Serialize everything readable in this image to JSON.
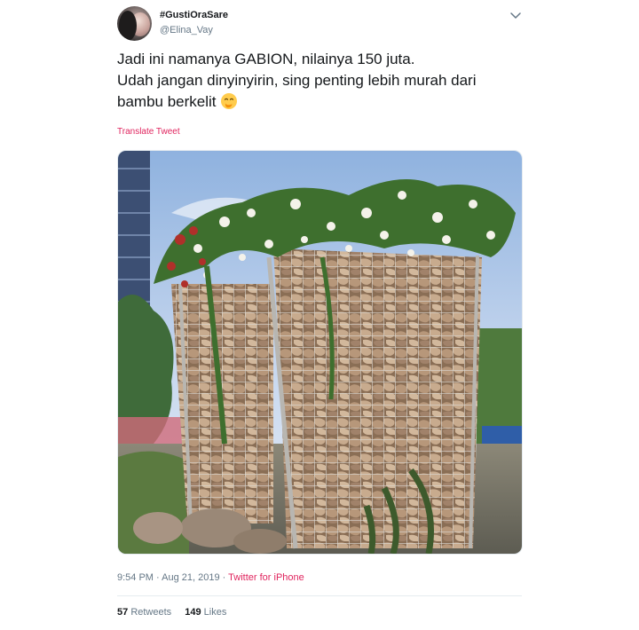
{
  "tweet": {
    "user": {
      "display_name": "#GustiOraSare",
      "handle": "@Elina_Vay"
    },
    "text_lines": [
      "Jadi ini namanya GABION, nilainya 150 juta.",
      "Udah jangan dinyinyirin, sing penting lebih murah dari",
      "bambu berkelit"
    ],
    "emoji": "face-with-hand-over-mouth-emoji",
    "translate_label": "Translate Tweet",
    "timestamp": "9:54 PM · Aug 21, 2019 · ",
    "source": "Twitter for iPhone",
    "retweets": {
      "count": "57",
      "label": "Retweets"
    },
    "likes": {
      "count": "149",
      "label": "Likes"
    },
    "colors": {
      "text": "#14171a",
      "secondary": "#657786",
      "accent": "#e0245e",
      "divider": "#e6ecf0"
    }
  }
}
